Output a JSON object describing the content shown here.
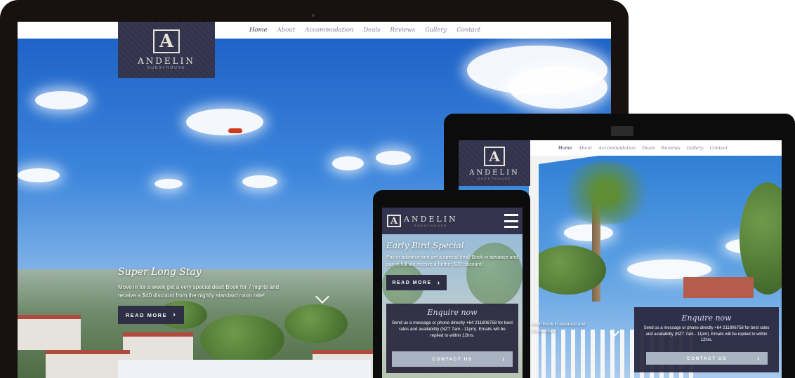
{
  "desktop": {
    "nav": [
      "Home",
      "About",
      "Accommodation",
      "Deals",
      "Reviews",
      "Gallery",
      "Contact"
    ],
    "active": "Home",
    "logo": {
      "name": "ANDELIN",
      "sub": "GUESTHOUSE"
    },
    "promo": {
      "title": "Super Long Stay",
      "text": "Move in for a week get a very special deal! Book for 7 nights and receive a $40 discount from the nightly standard room rate!",
      "button": "READ MORE"
    }
  },
  "tablet": {
    "nav": [
      "Home",
      "About",
      "Accommodation",
      "Deals",
      "Reviews",
      "Gallery",
      "Contact"
    ],
    "logo": {
      "name": "ANDELIN",
      "sub": "GUESTHOUSE"
    },
    "partial_text_1": "deal! Book in advance and",
    "partial_text_2": "20 discount!",
    "enquire": {
      "title": "Enquire now",
      "body": "Send us a message or phone directly +64 211806758 for best rates and availability (NZT 7am - 11pm). Emails will be replied to within 12hrs.",
      "button": "CONTACT US"
    }
  },
  "phone": {
    "logo": {
      "name": "ANDELIN",
      "sub": "GUESTHOUSE"
    },
    "promo": {
      "title": "Early Bird Special",
      "text": "Pay in advance and get a special deal! Book in advance and pay in full too receive a further $20 discount!",
      "button": "READ MORE"
    },
    "enquire": {
      "title": "Enquire now",
      "body": "Send us a message or phone directly +64 211806758 for best rates and availability (NZT 7am - 11pm). Emails will be replied to within 12hrs.",
      "button": "CONTACT US"
    }
  },
  "icons": {
    "chevron": "›",
    "down": "⌄",
    "menu": "☰"
  }
}
